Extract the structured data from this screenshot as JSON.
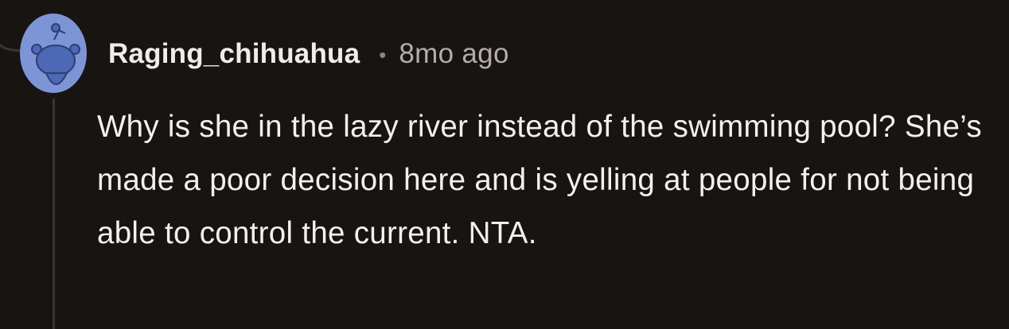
{
  "comment": {
    "author": "Raging_chihuahua",
    "separator": "•",
    "timestamp": "8mo ago",
    "body": "Why is she in the lazy river instead of the swimming pool? She’s made a poor decision here and is yelling at people for not being able to control the current. NTA."
  },
  "avatar": {
    "icon": "reddit-snoo-icon",
    "background_color": "#7d95d6",
    "figure_color": "#4d68b7"
  }
}
